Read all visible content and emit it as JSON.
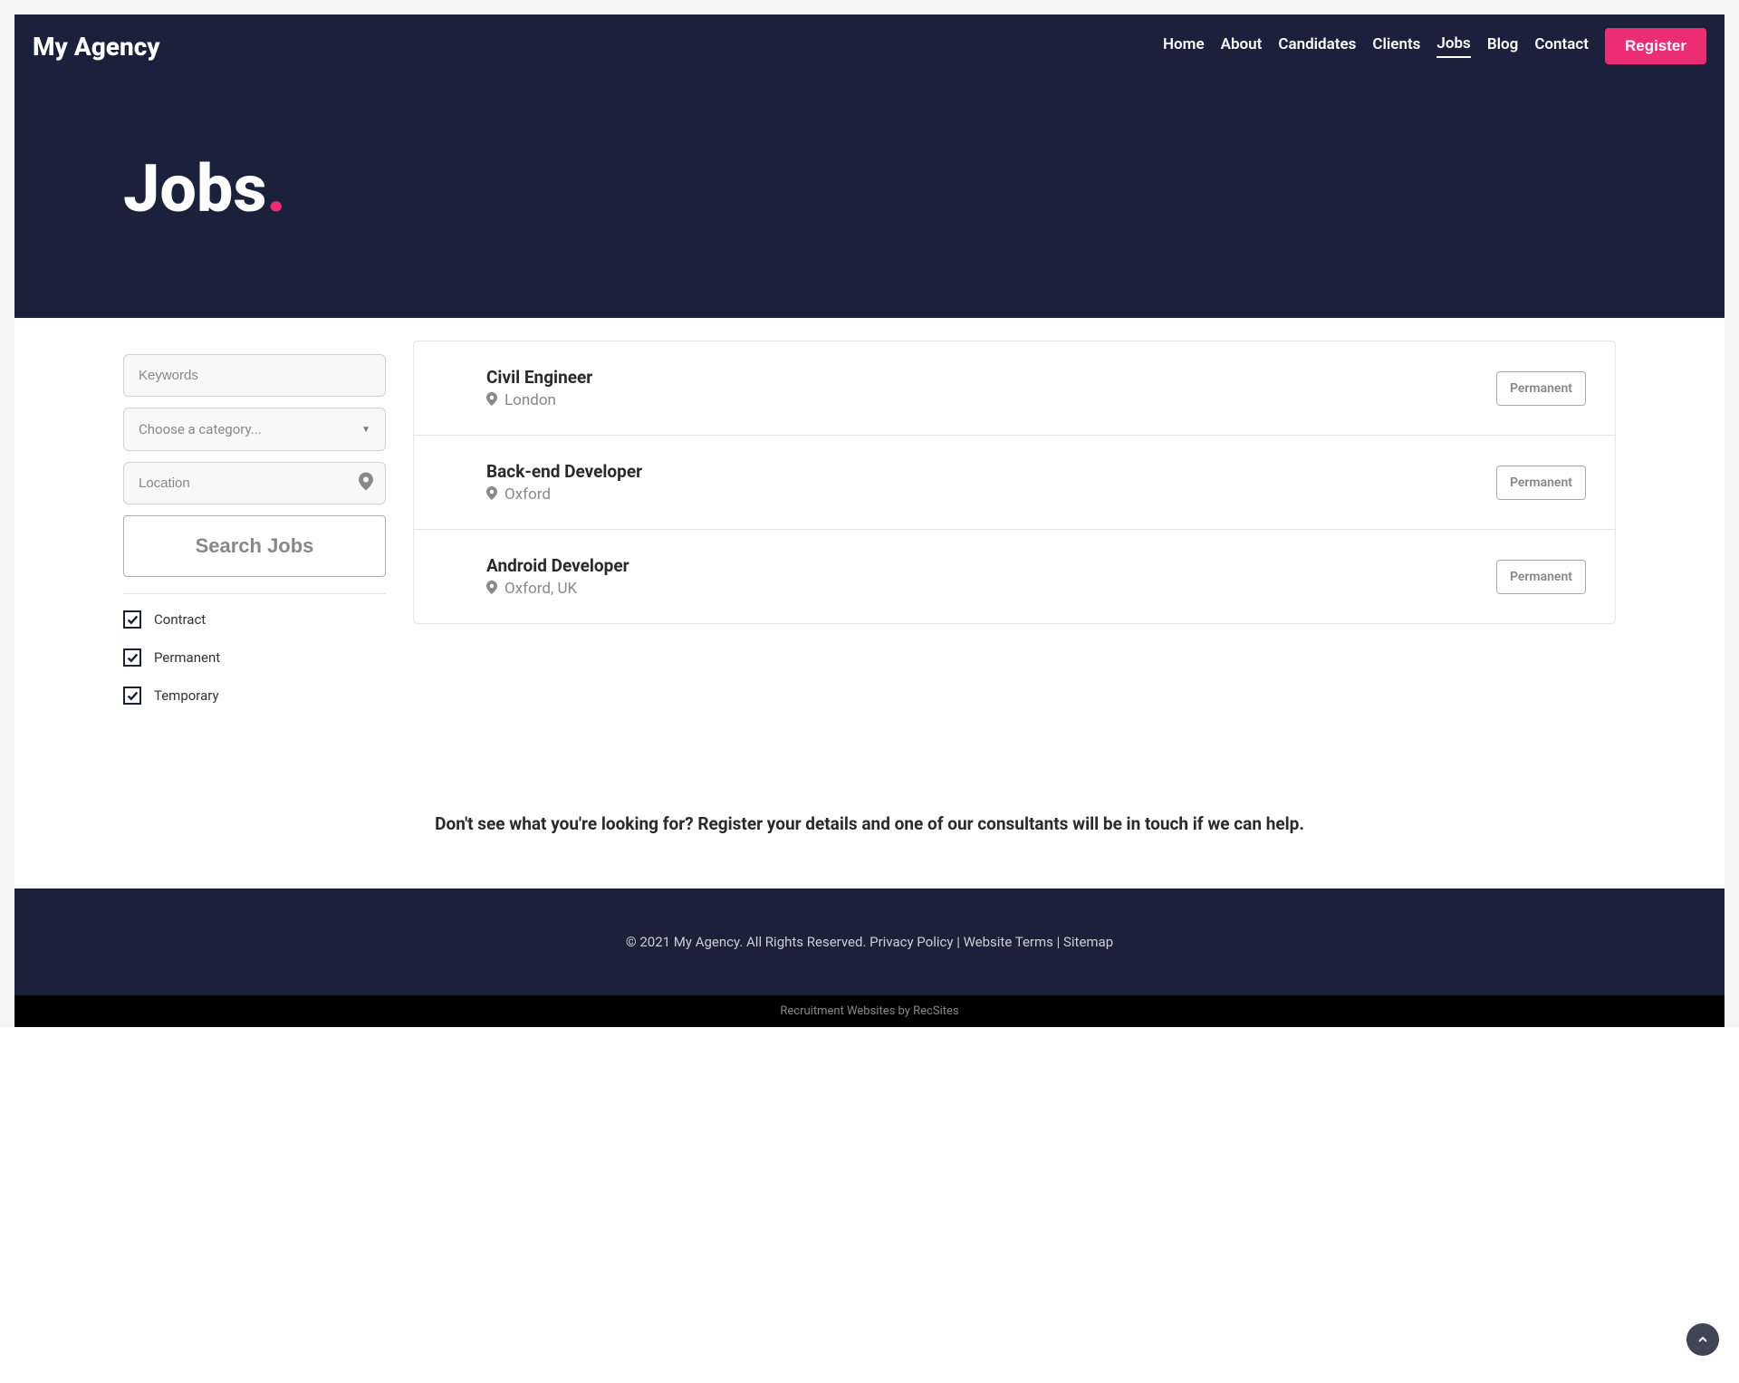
{
  "brand": "My Agency",
  "nav": {
    "items": [
      {
        "label": "Home",
        "active": false
      },
      {
        "label": "About",
        "active": false
      },
      {
        "label": "Candidates",
        "active": false
      },
      {
        "label": "Clients",
        "active": false
      },
      {
        "label": "Jobs",
        "active": true
      },
      {
        "label": "Blog",
        "active": false
      },
      {
        "label": "Contact",
        "active": false
      }
    ],
    "register": "Register"
  },
  "hero": {
    "title": "Jobs",
    "dot": "."
  },
  "search": {
    "keywords_placeholder": "Keywords",
    "category_placeholder": "Choose a category...",
    "location_placeholder": "Location",
    "button": "Search Jobs"
  },
  "filters": [
    {
      "label": "Contract",
      "checked": true
    },
    {
      "label": "Permanent",
      "checked": true
    },
    {
      "label": "Temporary",
      "checked": true
    }
  ],
  "jobs": [
    {
      "title": "Civil Engineer",
      "location": "London",
      "type": "Permanent"
    },
    {
      "title": "Back-end Developer",
      "location": "Oxford",
      "type": "Permanent"
    },
    {
      "title": "Android Developer",
      "location": "Oxford, UK",
      "type": "Permanent"
    }
  ],
  "cta": {
    "prefix": "Don't see what you're looking for? ",
    "link": "Register your details",
    "suffix": " and one of our consultants will be in touch if we can help."
  },
  "footer": {
    "copyright": "© 2021 My Agency. All Rights Reserved. ",
    "privacy": "Privacy Policy",
    "sep1": " | ",
    "terms": "Website Terms",
    "sep2": " | ",
    "sitemap": "Sitemap"
  },
  "subfooter": {
    "prefix": "Recruitment Websites by ",
    "link": "RecSites"
  }
}
